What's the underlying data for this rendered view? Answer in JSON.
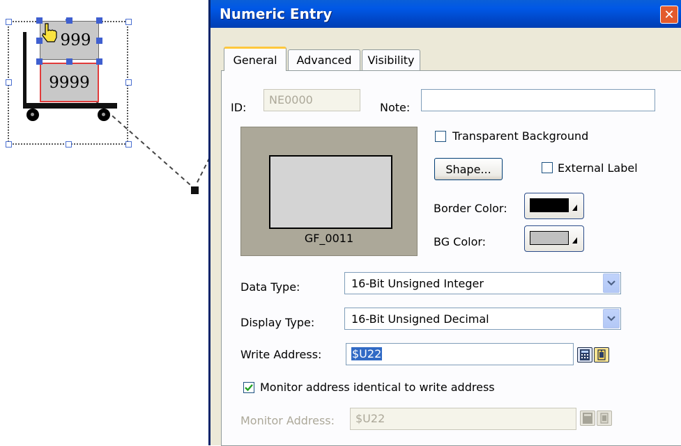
{
  "canvas": {
    "top_value": "999",
    "bottom_value": "9999"
  },
  "dialog": {
    "title": "Numeric Entry",
    "close_glyph": "✕",
    "tabs": [
      {
        "label": "General",
        "active": true
      },
      {
        "label": "Advanced",
        "active": false
      },
      {
        "label": "Visibility",
        "active": false
      }
    ],
    "id": {
      "label": "ID:",
      "value": "NE0000"
    },
    "note": {
      "label": "Note:",
      "value": ""
    },
    "preview": {
      "label": "GF_0011"
    },
    "transparent_background": {
      "label": "Transparent Background",
      "checked": false
    },
    "shape_button": "Shape...",
    "external_label": {
      "label": "External Label",
      "checked": false
    },
    "border_color": {
      "label": "Border Color:",
      "color": "#000000"
    },
    "bg_color": {
      "label": "BG Color:",
      "color": "#c0c0c0"
    },
    "data_type": {
      "label": "Data Type:",
      "value": "16-Bit Unsigned Integer"
    },
    "display_type": {
      "label": "Display Type:",
      "value": "16-Bit Unsigned Decimal"
    },
    "write_address": {
      "label": "Write Address:",
      "value": "$U22"
    },
    "monitor_identical": {
      "label": "Monitor address identical to write address",
      "checked": true
    },
    "monitor_address": {
      "label": "Monitor Address:",
      "value": "$U22"
    }
  },
  "icons": [
    "pointer-hand-icon",
    "calculator-icon",
    "tag-browse-icon",
    "close-icon",
    "chevron-down-icon",
    "checkmark-icon"
  ],
  "colors": {
    "titlebar": "#0058e6",
    "close": "#e35a2c",
    "selection": "#316ac5",
    "tab_highlight": "#ffc83c"
  }
}
